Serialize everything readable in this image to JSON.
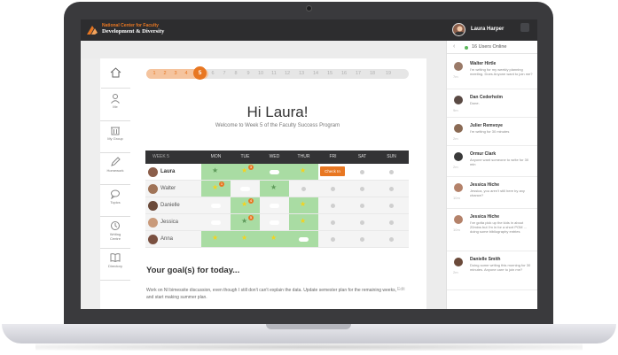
{
  "header": {
    "org_line1": "National Center for Faculty",
    "org_line2": "Development & Diversity",
    "user_name": "Laura Harper"
  },
  "nav": {
    "home_label": "",
    "items": [
      {
        "label": "Me",
        "icon": "person-icon"
      },
      {
        "label": "My Group",
        "icon": "trash-group-icon"
      },
      {
        "label": "Homework",
        "icon": "pencil-icon"
      },
      {
        "label": "Topics",
        "icon": "chat-bubble-icon"
      },
      {
        "label": "Writing Centre",
        "icon": "clock-icon"
      },
      {
        "label": "Directory",
        "icon": "book-icon"
      }
    ]
  },
  "progress": {
    "weeks": [
      "1",
      "2",
      "3",
      "4",
      "5",
      "6",
      "7",
      "8",
      "9",
      "10",
      "11",
      "12",
      "13",
      "14",
      "15",
      "16",
      "17",
      "18",
      "19"
    ],
    "current_week": "5"
  },
  "greeting": "Hi Laura!",
  "welcome": "Welcome to Week 5 of the Faculty Success Program",
  "schedule": {
    "week_label": "WEEK 5",
    "days": [
      "MON",
      "TUE",
      "WED",
      "THUR",
      "FRI",
      "SAT",
      "SUN"
    ],
    "checkin_label": "Check In",
    "rows": [
      {
        "name": "Laura"
      },
      {
        "name": "Walter"
      },
      {
        "name": "Danielle"
      },
      {
        "name": "Jessica"
      },
      {
        "name": "Anna"
      }
    ],
    "badges": {
      "laura_tue": "3",
      "walter_mon": "1",
      "danielle_tue": "4",
      "jessica_tue": "5"
    }
  },
  "goals": {
    "title": "Your goal(s) for today...",
    "text": "Work on NI bimessite discussion, even though I still don't can't explain the data. Update semester plan for the remaining weeks, and start making summer plan.",
    "edit_label": "Edit"
  },
  "chat": {
    "online_label": "16 Users Online",
    "messages": [
      {
        "name": "Walter Hirtle",
        "text": "I'm writing for my weekly planning meeting. Does Anyone want to join me?",
        "time": "7m"
      },
      {
        "name": "Dan Cederholm",
        "text": "Done.",
        "time": "9m"
      },
      {
        "name": "Julier Remvoye",
        "text": "I'm writing for 30 minutes",
        "time": "2m"
      },
      {
        "name": "Ormur Clark",
        "text": "Anyone want someone to write for 30 min",
        "time": "2m"
      },
      {
        "name": "Jessica Hiche",
        "text": "Jessica, you aren't still here by any chance?",
        "time": "10m"
      },
      {
        "name": "Jessica Hiche",
        "text": "I've gotta pick up the kids in about 20mins but I'm in for a short POM ... doing some bibliography entries",
        "time": "10m"
      },
      {
        "name": "Danielle Smith",
        "text": "Doing some writing this morning for 30 minutes. Anyone care to join me?",
        "time": "2m"
      }
    ]
  },
  "colors": {
    "accent": "#e87722",
    "green": "#a9dca3",
    "dark": "#2d2d2f"
  }
}
